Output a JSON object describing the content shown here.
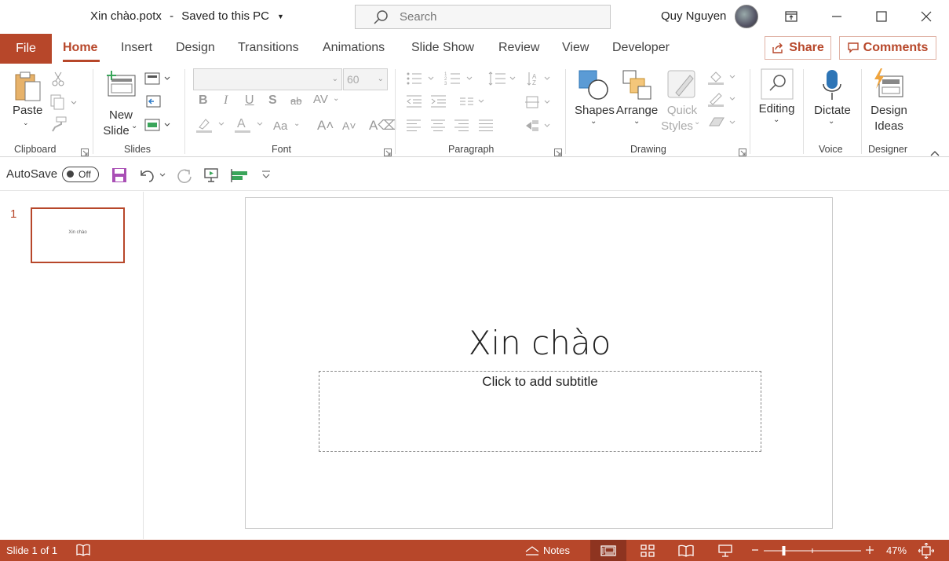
{
  "titlebar": {
    "doc_title": "Xin chào.potx",
    "save_state": "Saved to this PC",
    "search_placeholder": "Search",
    "user_name": "Quy Nguyen"
  },
  "tabs": {
    "file": "File",
    "items": [
      "Home",
      "Insert",
      "Design",
      "Transitions",
      "Animations",
      "Slide Show",
      "Review",
      "View",
      "Developer"
    ],
    "active": "Home",
    "share": "Share",
    "comments": "Comments"
  },
  "ribbon": {
    "clipboard": {
      "paste": "Paste",
      "group": "Clipboard"
    },
    "slides": {
      "new_slide_1": "New",
      "new_slide_2": "Slide",
      "group": "Slides"
    },
    "font": {
      "font_name": "",
      "font_size": "60",
      "group": "Font"
    },
    "paragraph": {
      "group": "Paragraph"
    },
    "drawing": {
      "shapes": "Shapes",
      "arrange": "Arrange",
      "quick_styles_1": "Quick",
      "quick_styles_2": "Styles",
      "group": "Drawing"
    },
    "editing": {
      "label": "Editing"
    },
    "voice": {
      "dictate": "Dictate",
      "group": "Voice"
    },
    "designer": {
      "design_ideas_1": "Design",
      "design_ideas_2": "Ideas",
      "group": "Designer"
    }
  },
  "qat": {
    "autosave": "AutoSave",
    "toggle": "Off"
  },
  "thumbnails": [
    {
      "number": "1",
      "title": "Xin chào"
    }
  ],
  "slide": {
    "title": "Xin chào",
    "subtitle_placeholder": "Click to add subtitle"
  },
  "status": {
    "slide_info": "Slide 1 of 1",
    "notes": "Notes",
    "zoom": "47%",
    "zoom_level": 0.47
  },
  "colors": {
    "accent": "#b7472a",
    "accent_dark": "#8e3420"
  }
}
